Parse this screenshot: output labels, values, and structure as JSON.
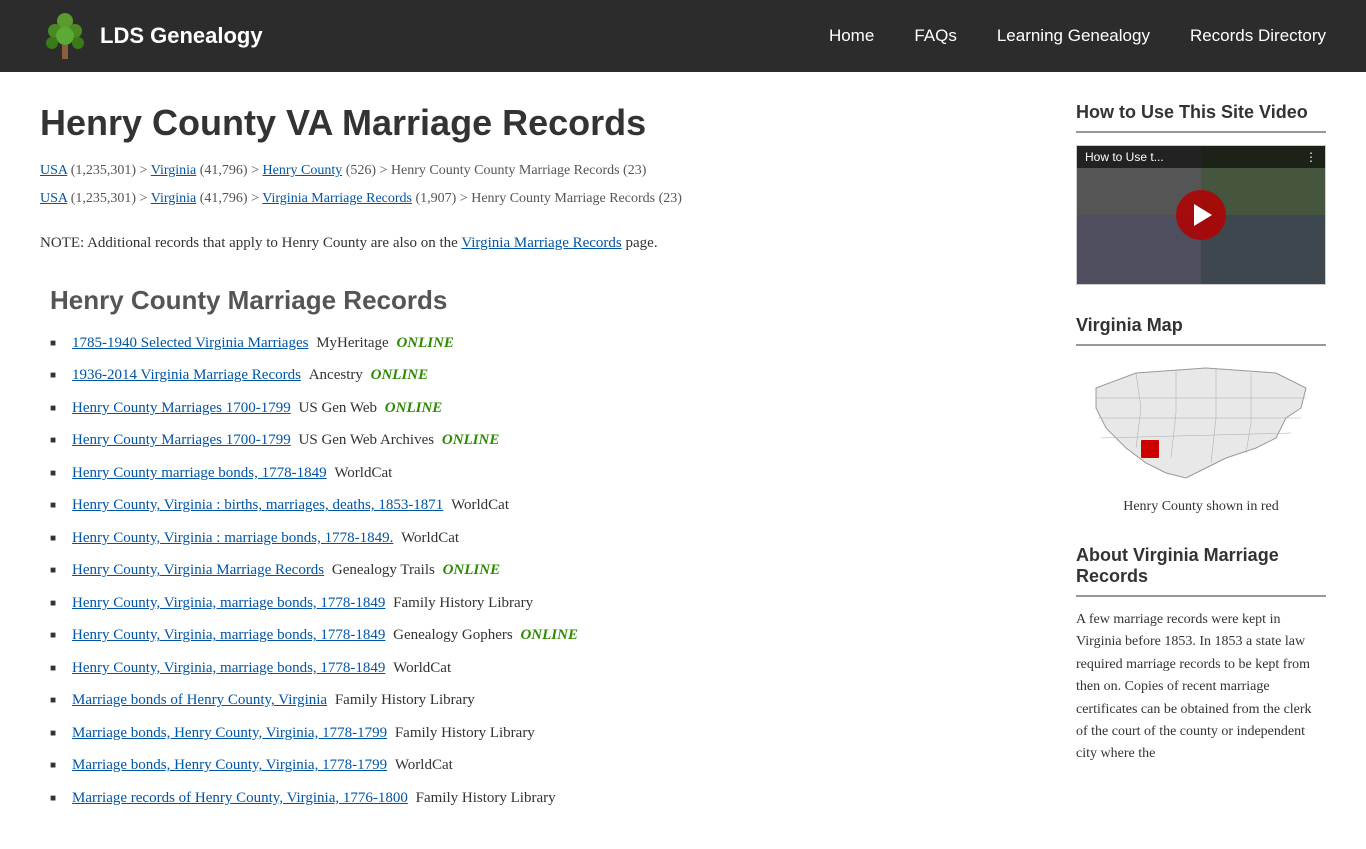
{
  "header": {
    "logo_text": "LDS Genealogy",
    "nav": [
      {
        "label": "Home",
        "href": "#"
      },
      {
        "label": "FAQs",
        "href": "#"
      },
      {
        "label": "Learning Genealogy",
        "href": "#"
      },
      {
        "label": "Records Directory",
        "href": "#"
      }
    ]
  },
  "main": {
    "title": "Henry County VA Marriage Records",
    "breadcrumbs": [
      {
        "items": [
          {
            "label": "USA",
            "href": "#",
            "count": "1,235,301"
          },
          {
            "label": "Virginia",
            "href": "#",
            "count": "41,796"
          },
          {
            "label": "Henry County",
            "href": "#",
            "count": "526"
          },
          {
            "label": "Henry County County Marriage Records",
            "count": "23",
            "href": null
          }
        ]
      },
      {
        "items": [
          {
            "label": "USA",
            "href": "#",
            "count": "1,235,301"
          },
          {
            "label": "Virginia",
            "href": "#",
            "count": "41,796"
          },
          {
            "label": "Virginia Marriage Records",
            "href": "#",
            "count": "1,907"
          },
          {
            "label": "Henry County Marriage Records",
            "count": "23",
            "href": null
          }
        ]
      }
    ],
    "note": "NOTE: Additional records that apply to Henry County are also on the",
    "note_link_text": "Virginia Marriage Records",
    "note_suffix": "page.",
    "section_title": "Henry County Marriage Records",
    "records": [
      {
        "link_text": "1785-1940 Selected Virginia Marriages",
        "source": "MyHeritage",
        "online": true
      },
      {
        "link_text": "1936-2014 Virginia Marriage Records",
        "source": "Ancestry",
        "online": true
      },
      {
        "link_text": "Henry County Marriages 1700-1799",
        "source": "US Gen Web",
        "online": true
      },
      {
        "link_text": "Henry County Marriages 1700-1799",
        "source": "US Gen Web Archives",
        "online": true
      },
      {
        "link_text": "Henry County marriage bonds, 1778-1849",
        "source": "WorldCat",
        "online": false
      },
      {
        "link_text": "Henry County, Virginia : births, marriages, deaths, 1853-1871",
        "source": "WorldCat",
        "online": false
      },
      {
        "link_text": "Henry County, Virginia : marriage bonds, 1778-1849.",
        "source": "WorldCat",
        "online": false
      },
      {
        "link_text": "Henry County, Virginia Marriage Records",
        "source": "Genealogy Trails",
        "online": true
      },
      {
        "link_text": "Henry County, Virginia, marriage bonds, 1778-1849",
        "source": "Family History Library",
        "online": false
      },
      {
        "link_text": "Henry County, Virginia, marriage bonds, 1778-1849",
        "source": "Genealogy Gophers",
        "online": true
      },
      {
        "link_text": "Henry County, Virginia, marriage bonds, 1778-1849",
        "source": "WorldCat",
        "online": false
      },
      {
        "link_text": "Marriage bonds of Henry County, Virginia",
        "source": "Family History Library",
        "online": false
      },
      {
        "link_text": "Marriage bonds, Henry County, Virginia, 1778-1799",
        "source": "Family History Library",
        "online": false
      },
      {
        "link_text": "Marriage bonds, Henry County, Virginia, 1778-1799",
        "source": "WorldCat",
        "online": false
      },
      {
        "link_text": "Marriage records of Henry County, Virginia, 1776-1800",
        "source": "Family History Library",
        "online": false
      }
    ]
  },
  "sidebar": {
    "video_section": {
      "title": "How to Use This Site Video",
      "video_label": "How to Use t..."
    },
    "map_section": {
      "title": "Virginia Map",
      "caption": "Henry County shown in red"
    },
    "about_section": {
      "title": "About Virginia Marriage Records",
      "text": "A few marriage records were kept in Virginia before 1853. In 1853 a state law required marriage records to be kept from then on. Copies of recent marriage certificates can be obtained from the clerk of the court of the county or independent city where the"
    }
  }
}
